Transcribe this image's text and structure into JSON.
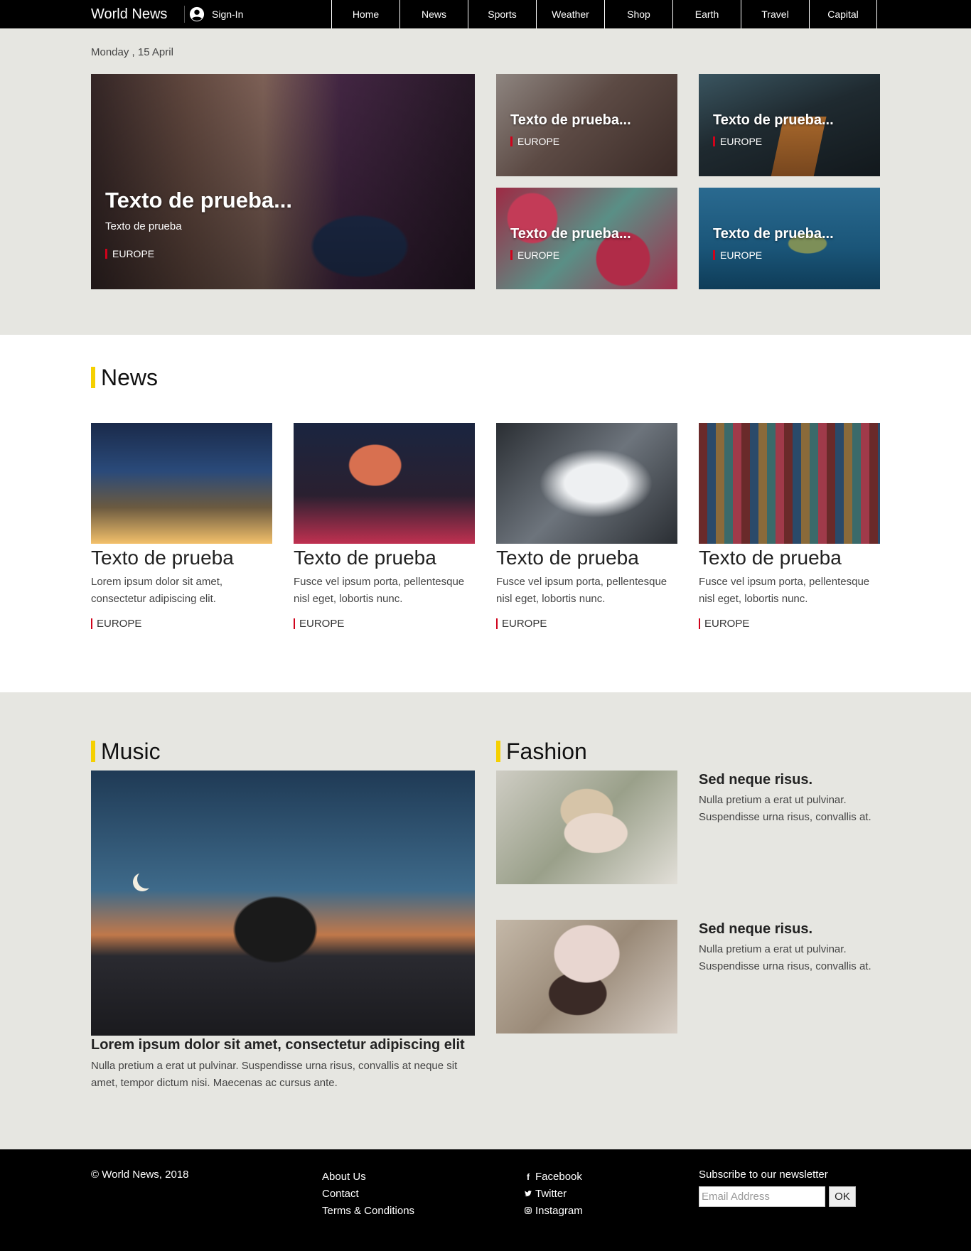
{
  "header": {
    "brand": "World News",
    "signin_label": "Sign-In",
    "nav": [
      "Home",
      "News",
      "Sports",
      "Weather",
      "Shop",
      "Earth",
      "Travel",
      "Capital"
    ]
  },
  "hero": {
    "date": "Monday , 15 April",
    "main": {
      "title": "Texto de prueba...",
      "subtitle": "Texto de prueba",
      "tag": "EUROPE"
    },
    "cards": [
      {
        "title": "Texto de prueba...",
        "tag": "EUROPE"
      },
      {
        "title": "Texto de prueba...",
        "tag": "EUROPE"
      },
      {
        "title": "Texto de prueba...",
        "tag": "EUROPE"
      },
      {
        "title": "Texto de prueba...",
        "tag": "EUROPE"
      }
    ]
  },
  "news": {
    "title": "News",
    "items": [
      {
        "title": "Texto de prueba",
        "text": "Lorem ipsum dolor sit amet, consectetur adipiscing elit.",
        "tag": "EUROPE"
      },
      {
        "title": "Texto de prueba",
        "text": "Fusce vel ipsum porta, pellentesque nisl eget, lobortis nunc.",
        "tag": "EUROPE"
      },
      {
        "title": "Texto de prueba",
        "text": "Fusce vel ipsum porta, pellentesque nisl eget, lobortis nunc.",
        "tag": "EUROPE"
      },
      {
        "title": "Texto de prueba",
        "text": "Fusce vel ipsum porta, pellentesque nisl eget, lobortis nunc.",
        "tag": "EUROPE"
      }
    ]
  },
  "music": {
    "title": "Music",
    "headline": "Lorem ipsum dolor sit amet, consectetur adipiscing elit",
    "text": "Nulla pretium a erat ut pulvinar. Suspendisse urna risus, convallis at neque sit amet, tempor dictum nisi. Maecenas ac cursus ante."
  },
  "fashion": {
    "title": "Fashion",
    "items": [
      {
        "title": "Sed neque risus.",
        "text": "Nulla pretium a erat ut pulvinar. Suspendisse urna risus, convallis at."
      },
      {
        "title": "Sed neque risus.",
        "text": "Nulla pretium a erat ut pulvinar. Suspendisse urna risus, convallis at."
      }
    ]
  },
  "footer": {
    "copyright": "© World News, 2018",
    "links": [
      "About Us",
      "Contact",
      "Terms & Conditions"
    ],
    "social": [
      {
        "icon": "facebook-icon",
        "label": "Facebook"
      },
      {
        "icon": "twitter-icon",
        "label": "Twitter"
      },
      {
        "icon": "instagram-icon",
        "label": "Instagram"
      }
    ],
    "newsletter_title": "Subscribe to our newsletter",
    "newsletter_placeholder": "Email Address",
    "newsletter_button": "OK"
  },
  "colors": {
    "accent_yellow": "#f5d000",
    "tag_red": "#d0021b",
    "section_bg": "#e6e6e1"
  }
}
